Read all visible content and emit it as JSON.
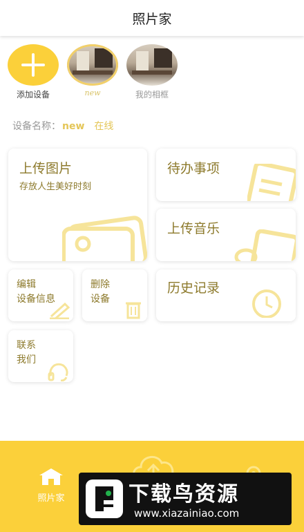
{
  "header": {
    "title": "照片家"
  },
  "devices": [
    {
      "label": "添加设备"
    },
    {
      "label": "new"
    },
    {
      "label": "我的相框"
    }
  ],
  "device_info": {
    "name_label": "设备名称：",
    "name_value": "new",
    "status": "在线"
  },
  "cards": {
    "upload_photo": {
      "title": "上传图片",
      "subtitle": "存放人生美好时刻"
    },
    "todo": {
      "title": "待办事项"
    },
    "upload_music": {
      "title": "上传音乐"
    },
    "edit_device": {
      "line1": "编辑",
      "line2": "设备信息"
    },
    "delete_device": {
      "line1": "删除",
      "line2": "设备"
    },
    "history": {
      "title": "历史记录"
    },
    "contact": {
      "line1": "联系",
      "line2": "我们"
    }
  },
  "tabbar": {
    "home": "照片家"
  },
  "watermark": {
    "title": "下载鸟资源",
    "url": "www.xiazainiao.com"
  },
  "colors": {
    "accent": "#fbd03a",
    "card_text": "#8d7a2c",
    "deco": "#f6e49a"
  }
}
